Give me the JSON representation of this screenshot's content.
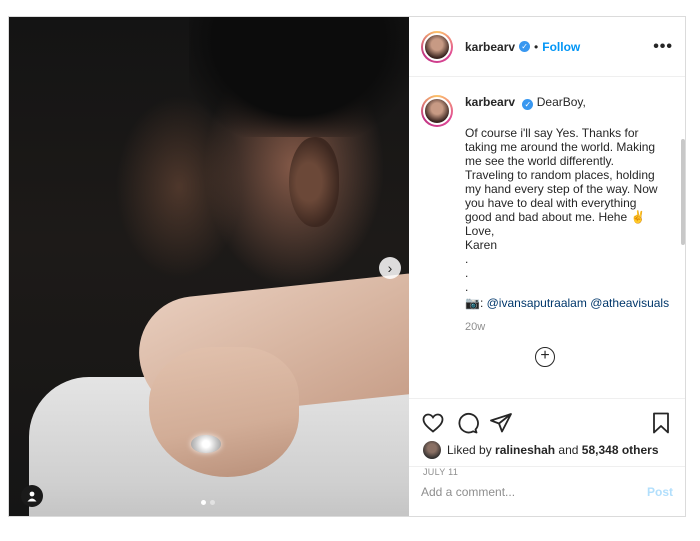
{
  "post": {
    "username": "karbearv",
    "separator": "•",
    "follow_label": "Follow",
    "more_label": "•••",
    "carousel": {
      "slides": 2,
      "active_slide": 1,
      "next_arrow": "›"
    }
  },
  "caption": {
    "username": "karbearv",
    "opening": "DearBoy,",
    "text": "Of course i'll say Yes. Thanks for taking me around the world. Making me see the world differently. Traveling to random places, holding my hand every step of the way. Now you have to deal with everything good and bad about me. Hehe ✌\nLove,\nKaren\n.\n.\n.",
    "credit_icon": "📷",
    "mentions": [
      "@ivansaputraalam",
      "@atheavisuals"
    ],
    "time_ago": "20w",
    "load_more_label": "+"
  },
  "engagement": {
    "liked_by_prefix": "Liked by",
    "liked_by_user": "ralineshah",
    "and_label": "and",
    "others_count": "58,348 others",
    "date": "JULY 11"
  },
  "comment": {
    "placeholder": "Add a comment...",
    "post_label": "Post"
  },
  "icons": {
    "heart": "heart-icon",
    "comment": "comment-icon",
    "share": "share-icon",
    "bookmark": "bookmark-icon",
    "tag": "user-tag-icon"
  },
  "colors": {
    "accent_blue": "#0095f6",
    "verified_blue": "#3897f0",
    "post_disabled": "#b2dffc",
    "muted_text": "#8e8e8e"
  }
}
